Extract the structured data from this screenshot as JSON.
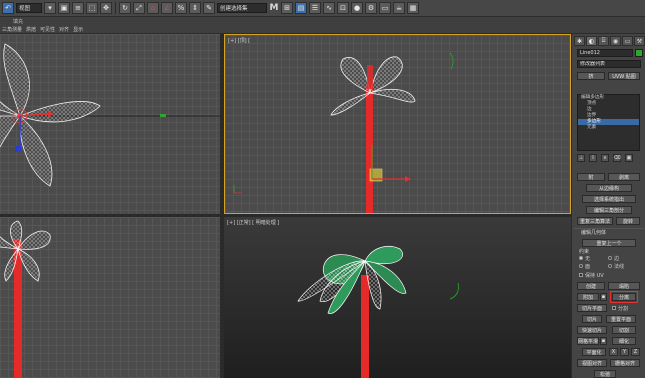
{
  "toolbar": {
    "view_select": "视图",
    "selection_set": "创建选择集",
    "letter_m": "M"
  },
  "ribbon": {
    "fill_label": "填充",
    "tabs": [
      "三角测量",
      "烘焙",
      "可见性",
      "对齐",
      "显示"
    ]
  },
  "viewports": {
    "top_right_label": "[+] [顶] [",
    "bottom_right_label": "[+] [正常] [ 明暗处理 ]",
    "active_border_color": "#d4a321"
  },
  "panel": {
    "object_name": "Line012",
    "object_color": "#2ca62c",
    "modifier_list": "修改器列表",
    "btn_xform": "挤",
    "btn_uvw": "UVW 贴图",
    "stack": [
      "编辑多边形",
      "顶点",
      "边",
      "边界",
      "多边形",
      "元素"
    ],
    "stack_selected_index": 4,
    "btn_attach": "附",
    "btn_detach": "剥离",
    "btn_slice_one": "从边缘构",
    "btn_from_edge": "选择系统指出",
    "btn_edit_tri": "编辑三角剖分",
    "btn_retri": "重复三角算法",
    "btn_rotate": "旋转",
    "rollout_edit_geo": "编辑几何体",
    "btn_repeat_last": "重复上一个",
    "label_constraint": "约束",
    "radio_none": "无",
    "radio_edge": "边",
    "radio_face": "面",
    "radio_normal": "法线",
    "check_preserve_uv": "保持 UV",
    "btn_create": "创建",
    "btn_collapse": "塌陷",
    "btn_attach2": "附加",
    "btn_detach_hl": "分离",
    "btn_slice_plane": "切片平面",
    "btn_split": "分割",
    "btn_slice": "切片",
    "btn_reset_plane": "重置平面",
    "btn_quickslice": "快速切片",
    "btn_cut": "切割",
    "btn_msmooth": "网格平滑",
    "btn_tessellate": "细化",
    "btn_planar": "平面化",
    "btn_x": "X",
    "btn_y": "Y",
    "btn_z": "Z",
    "btn_view_align": "视图对齐",
    "btn_grid_align": "栅格对齐",
    "btn_relax": "松弛"
  }
}
